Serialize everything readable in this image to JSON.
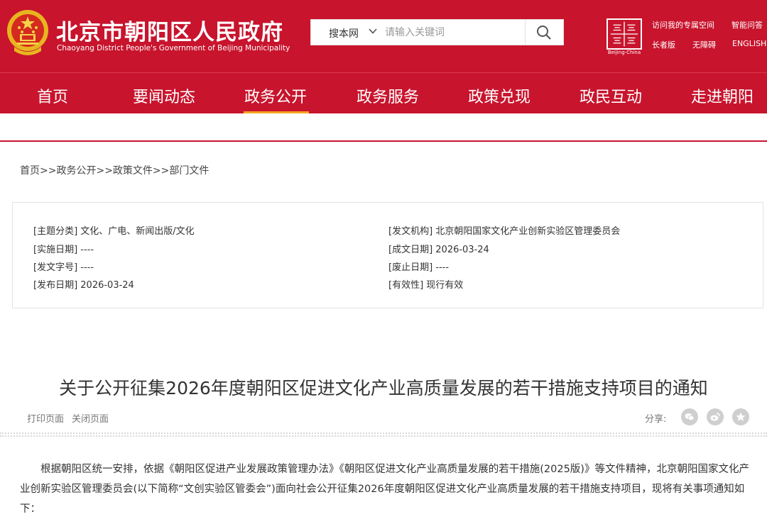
{
  "header": {
    "site_title": "北京市朝阳区人民政府",
    "site_subtitle": "Chaoyang District People's Government of Beijing Municipality",
    "search": {
      "scope": "搜本网",
      "placeholder": "请输入关键词"
    },
    "seal_caption": "Beijing-China",
    "links": {
      "space": "访问我的专属空间",
      "assistant": "智能问答",
      "elder": "长者版",
      "barrier_free": "无障碍",
      "english": "ENGLISH"
    }
  },
  "nav": {
    "items": [
      "首页",
      "要闻动态",
      "政务公开",
      "政务服务",
      "政策兑现",
      "政民互动",
      "走进朝阳"
    ],
    "active_index": 2
  },
  "breadcrumb": "首页>>政务公开>>政策文件>>部门文件",
  "meta": {
    "topic": "[主题分类] 文化、广电、新闻出版/文化",
    "effective_date": "[实施日期] ----",
    "doc_number": "[发文字号] ----",
    "publish_date": "[发布日期] 2026-03-24",
    "issuer": "[发文机构] 北京朝阳国家文化产业创新实验区管理委员会",
    "written_date": "[成文日期] 2026-03-24",
    "repeal_date": "[废止日期] ----",
    "validity": "[有效性] 现行有效"
  },
  "article": {
    "title": "关于公开征集2026年度朝阳区促进文化产业高质量发展的若干措施支持项目的通知",
    "print_label": "打印页面",
    "close_label": "关闭页面",
    "share_label": "分享:",
    "body": "根据朝阳区统一安排，依据《朝阳区促进产业发展政策管理办法》《朝阳区促进文化产业高质量发展的若干措施(2025版)》等文件精神，北京朝阳国家文化产业创新实验区管理委员会(以下简称“文创实验区管委会”)面向社会公开征集2026年度朝阳区促进文化产业高质量发展的若干措施支持项目，现将有关事项通知如下："
  },
  "colors": {
    "brand_red": "#c8142d",
    "accent_gold": "#f5a623",
    "share_grey": "#cfcfcf"
  },
  "icons": [
    "national-emblem-icon",
    "chevron-down-icon",
    "search-icon",
    "capital-seal-icon",
    "wechat-icon",
    "weibo-icon",
    "favorite-star-icon"
  ]
}
